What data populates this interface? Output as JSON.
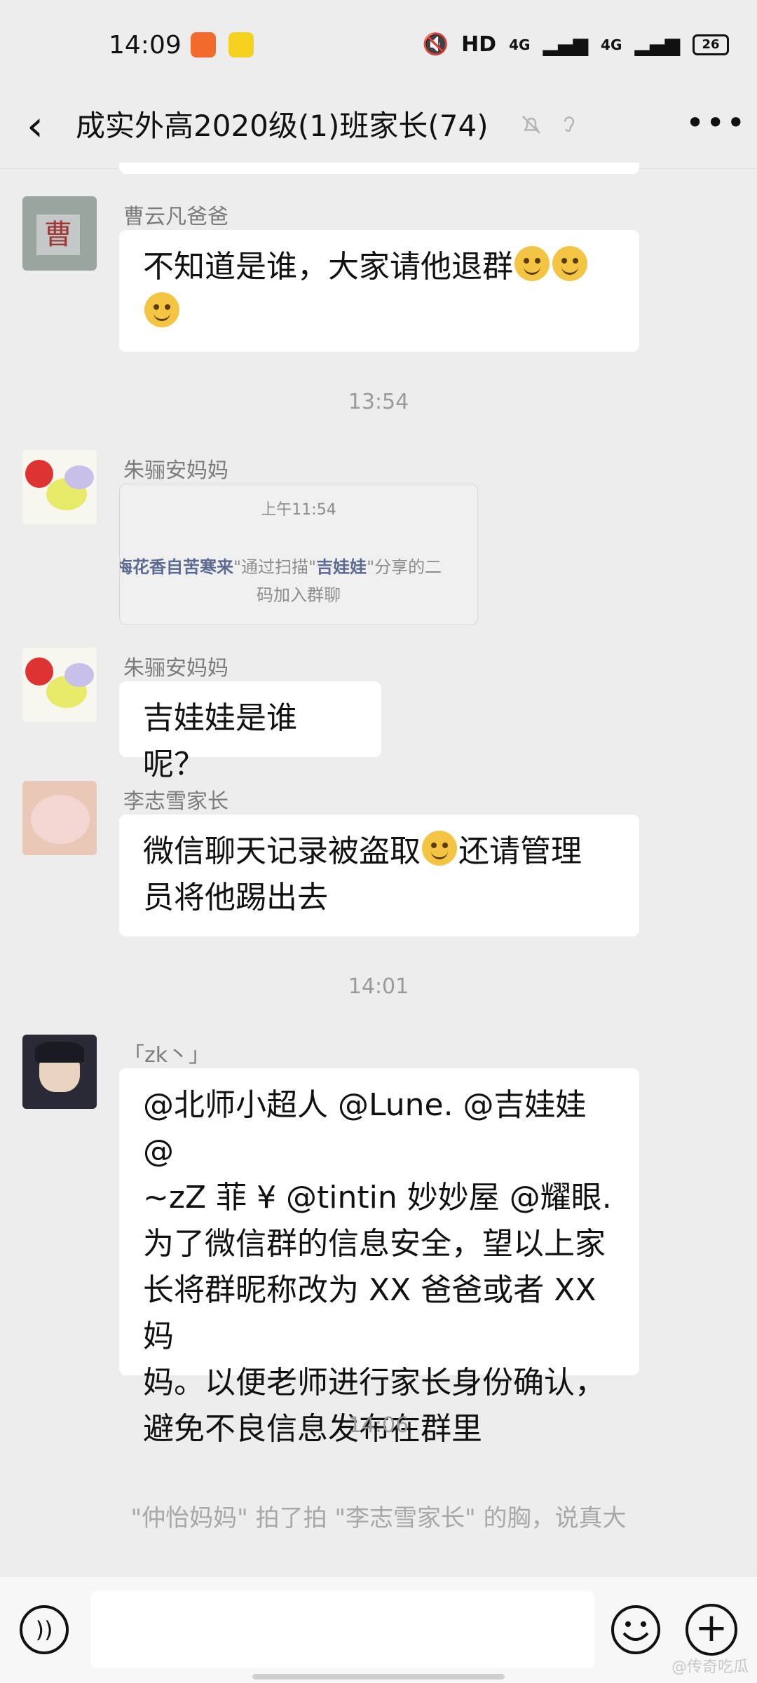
{
  "status": {
    "time": "14:09",
    "hd": "HD",
    "net1": "4G",
    "net2": "4G",
    "battery": "26"
  },
  "nav": {
    "title": "成实外高2020级(1)班家长(74)",
    "more": "•••"
  },
  "messages": {
    "m1": {
      "sender": "曹云凡爸爸",
      "avatar_char": "曹",
      "text_a": "不知道是谁，大家请他退群",
      "text_b": ""
    },
    "t1": "13:54",
    "m2": {
      "sender": "朱骊安妈妈",
      "card_time": "上午11:54",
      "card_name1": "梅花香自苦寒来",
      "card_mid": "\"通过扫描\"",
      "card_name2": "吉娃娃",
      "card_end": "\"分享的二",
      "card_line2": "码加入群聊"
    },
    "m3": {
      "sender": "朱骊安妈妈",
      "text": "吉娃娃是谁呢？"
    },
    "m4": {
      "sender": "李志雪家长",
      "text_a": "微信聊天记录被盗取",
      "text_b": "还请管理",
      "text_c": "员将他踢出去"
    },
    "t2": "14:01",
    "m5": {
      "sender": "「zk丶」",
      "lines": [
        "@北师小超人  @Lune. @吉娃娃  @",
        "~zZ 菲 ¥ @tintin 妙妙屋  @耀眼.",
        "为了微信群的信息安全，望以上家",
        "长将群昵称改为 XX 爸爸或者 XX 妈",
        "妈。以便老师进行家长身份确认，",
        "避免不良信息发布在群里"
      ]
    },
    "t3": "14:06",
    "notice": "\"仲怡妈妈\" 拍了拍 \"李志雪家长\" 的胸，说真大"
  },
  "watermark": "@传奇吃瓜",
  "colors": {
    "background": "#ededed",
    "bubble": "#ffffff",
    "muted": "#9a9a9a"
  }
}
